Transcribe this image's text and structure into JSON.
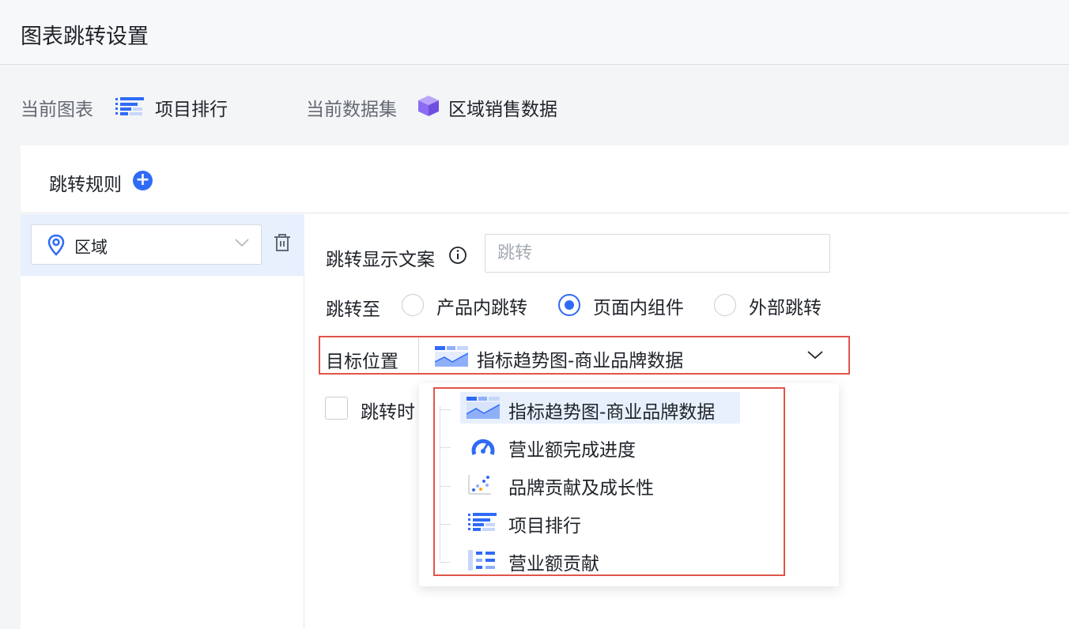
{
  "header": {
    "title": "图表跳转设置"
  },
  "info": {
    "chart_label": "当前图表",
    "chart_name": "项目排行",
    "dataset_label": "当前数据集",
    "dataset_name": "区域销售数据"
  },
  "rules": {
    "title": "跳转规则",
    "add_label": "+",
    "field_select": "区域"
  },
  "form": {
    "display_text_label": "跳转显示文案",
    "display_text_placeholder": "跳转",
    "jump_to_label": "跳转至",
    "options": [
      "产品内跳转",
      "页面内组件",
      "外部跳转"
    ],
    "selected_option": "页面内组件",
    "target_label": "目标位置",
    "target_value": "指标趋势图-商业品牌数据",
    "checkbox_label": "跳转时"
  },
  "dropdown": {
    "items": [
      {
        "label": "指标趋势图-商业品牌数据",
        "icon": "area-chart-icon",
        "active": true
      },
      {
        "label": "营业额完成进度",
        "icon": "gauge-icon",
        "active": false
      },
      {
        "label": "品牌贡献及成长性",
        "icon": "scatter-chart-icon",
        "active": false
      },
      {
        "label": "项目排行",
        "icon": "bar-list-icon",
        "active": false
      },
      {
        "label": "营业额贡献",
        "icon": "tree-bar-icon",
        "active": false
      }
    ]
  },
  "colors": {
    "accent": "#2f6bf6",
    "highlight_border": "#e0554a",
    "dataset_icon": "#8c6cf2"
  }
}
